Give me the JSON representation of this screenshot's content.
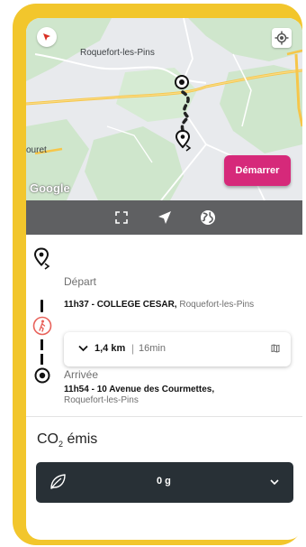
{
  "map": {
    "town_label": "Roquefort-les-Pins",
    "partial_label": "ouret",
    "google_label": "Google",
    "start_button": "Démarrer"
  },
  "departure": {
    "label": "Départ",
    "time_stop": "11h37 - COLLEGE CESAR,",
    "locality": " Roquefort-les-Pins"
  },
  "segment": {
    "distance": "1,4 km",
    "separator": "|",
    "duration": "16min"
  },
  "arrival": {
    "label": "Arrivée",
    "time_stop": "11h54 - 10 Avenue des Courmettes,",
    "locality": "Roquefort-les-Pins"
  },
  "co2": {
    "title_prefix": "CO",
    "title_sub": "2",
    "title_suffix": " émis",
    "value": "0 g"
  },
  "colors": {
    "frame": "#f2c62c",
    "accent": "#d6297a",
    "toolbar": "#5f6062",
    "co2_bar": "#283036",
    "walk_marker": "#e8615a"
  },
  "icons": [
    "compass-icon",
    "locate-icon",
    "fullscreen-icon",
    "navigation-arrow-icon",
    "globe-icon",
    "route-pin-icon",
    "walking-icon",
    "destination-icon",
    "chevron-down-icon",
    "map-book-icon",
    "leaf-icon"
  ]
}
